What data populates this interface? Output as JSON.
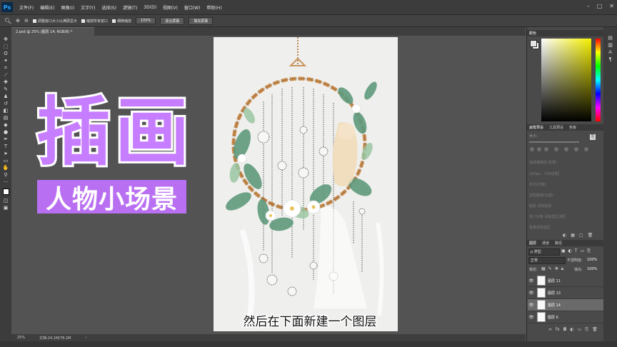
{
  "app": {
    "logo": "Ps"
  },
  "menu": [
    "文件(F)",
    "编辑(E)",
    "图像(I)",
    "文字(Y)",
    "选择(S)",
    "滤镜(T)",
    "3D(D)",
    "视图(V)",
    "窗口(W)",
    "帮助(H)"
  ],
  "window_controls": [
    "–",
    "□",
    "✕"
  ],
  "options_bar": {
    "resize_windows": "调整窗口大小以满屏显示",
    "zoom_all": "缩放所有窗口",
    "scrubby_zoom": "细微缩放",
    "zoom_value": "100%",
    "fit_screen": "适合屏幕",
    "fill_screen": "填充屏幕"
  },
  "document": {
    "tab": "2.psd @ 25% (图层 14, RGB/8) *"
  },
  "status": {
    "zoom": "25%",
    "doc_size": "文档:24.1M/78.2M"
  },
  "panels": {
    "color": {
      "tab": "颜色"
    },
    "brush_tabs": [
      "画笔预设",
      "工具预设",
      "色板"
    ],
    "brush_size_label": "大小:",
    "history_items": [
      "油漆桶填充(背景)",
      "180px, 【28切笔】",
      "布尔(打散)",
      "剪贴蒙版(勾选)",
      "粘贴 添加投影",
      "单个对象 添加选区减区",
      "批量去除选区"
    ],
    "layers_tabs": [
      "图层",
      "通道",
      "路径"
    ],
    "filter_kind": "ρ 类型",
    "blend_mode": "正常",
    "opacity_label": "不透明度:",
    "opacity_value": "100%",
    "lock_label": "锁定:",
    "fill_label": "填充:",
    "fill_value": "100%",
    "layers": [
      {
        "name": "图层 11",
        "active": false
      },
      {
        "name": "图层 13",
        "active": false
      },
      {
        "name": "图层 14",
        "active": true
      },
      {
        "name": "图层 6",
        "active": false
      }
    ]
  },
  "overlay": {
    "title": "插画",
    "subtitle": "人物小场景",
    "caption": "然后在下面新建一个图层"
  }
}
